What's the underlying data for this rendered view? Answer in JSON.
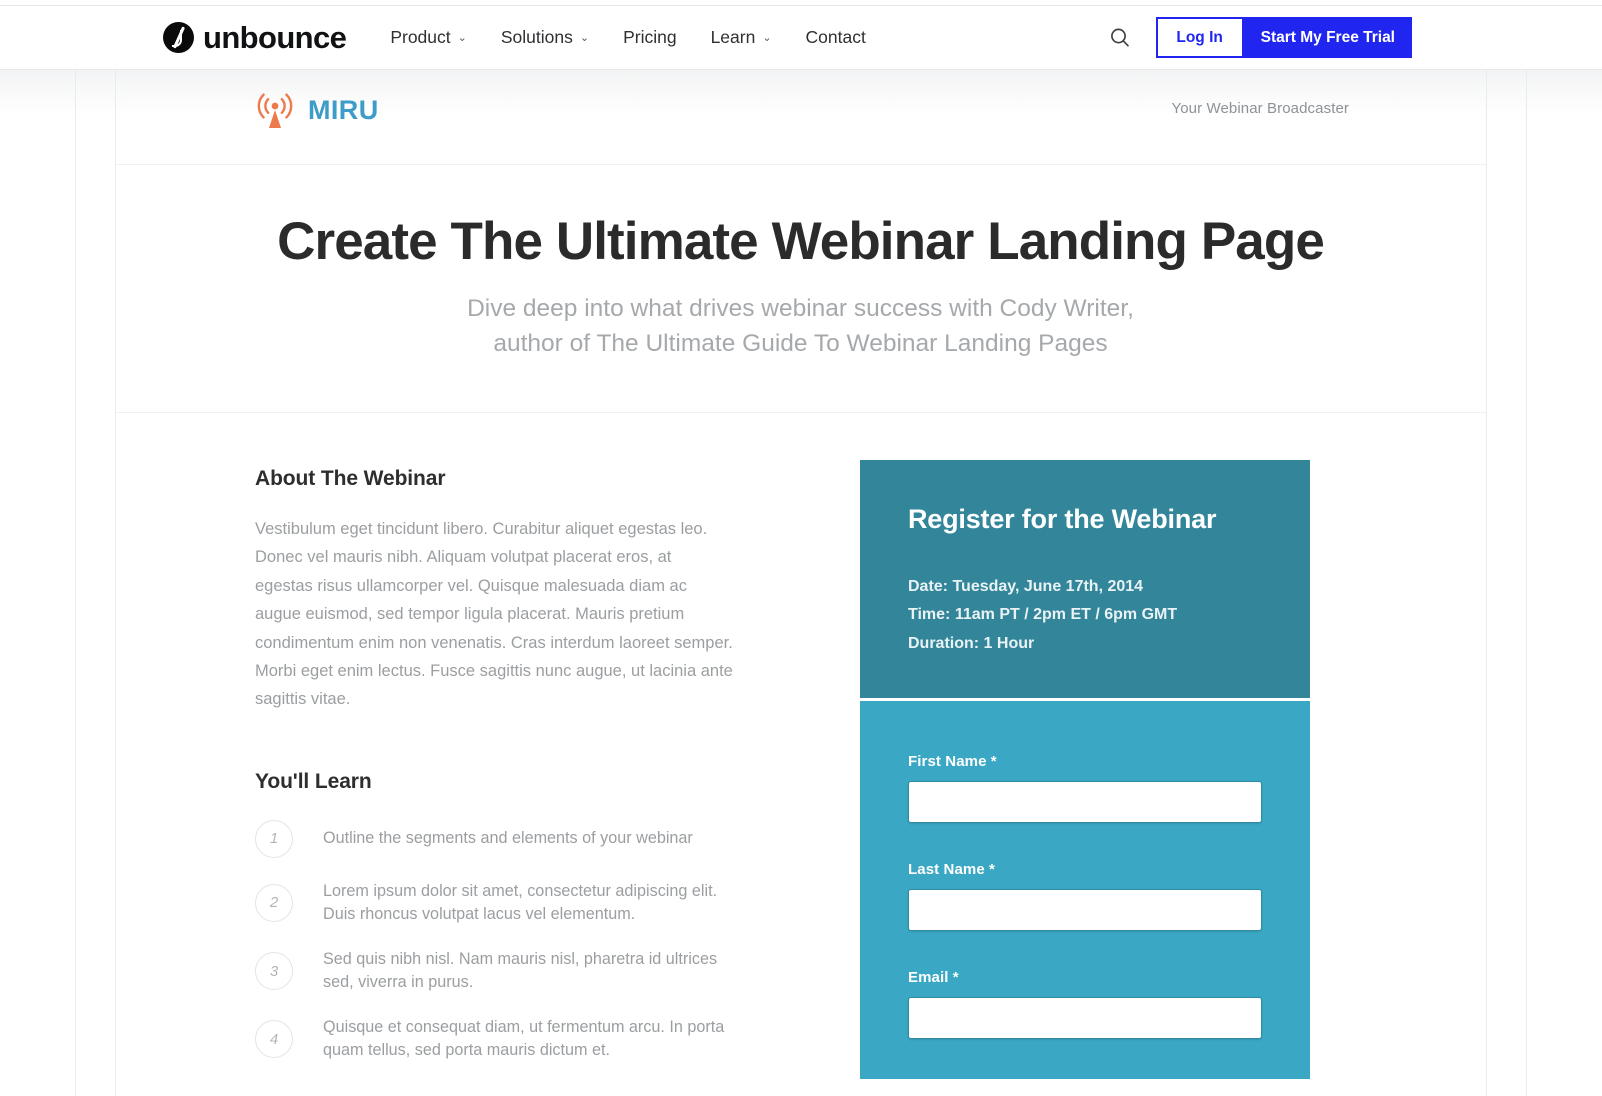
{
  "navbar": {
    "brand": "unbounce",
    "links": [
      {
        "label": "Product",
        "has_dropdown": true
      },
      {
        "label": "Solutions",
        "has_dropdown": true
      },
      {
        "label": "Pricing",
        "has_dropdown": false
      },
      {
        "label": "Learn",
        "has_dropdown": true
      },
      {
        "label": "Contact",
        "has_dropdown": false
      }
    ],
    "caret": "⌄",
    "search_icon": "search-icon",
    "login_label": "Log In",
    "trial_label": "Start My Free Trial",
    "accent_color": "#2026ef"
  },
  "page_header": {
    "logo_text": "MIRU",
    "logo_icon": "broadcast-antenna-icon",
    "logo_icon_color": "#ec7a4d",
    "logo_text_color": "#3e9cc9",
    "tagline": "Your Webinar Broadcaster"
  },
  "hero": {
    "title": "Create The Ultimate Webinar Landing Page",
    "subtitle_line_1": "Dive deep into what drives webinar success with Cody Writer,",
    "subtitle_line_2": "author of The Ultimate Guide To Webinar Landing Pages"
  },
  "about": {
    "heading": "About The Webinar",
    "paragraph": "Vestibulum eget tincidunt libero. Curabitur aliquet egestas leo. Donec vel mauris nibh. Aliquam volutpat placerat eros, at egestas risus ullamcorper vel. Quisque malesuada diam ac augue euismod, sed tempor ligula placerat. Mauris pretium condimentum enim non venenatis. Cras interdum laoreet semper. Morbi eget enim lectus. Fusce sagittis nunc augue, ut lacinia ante sagittis vitae."
  },
  "learn": {
    "heading": "You'll Learn",
    "items": [
      {
        "number": "1",
        "text": "Outline the segments and elements of your webinar"
      },
      {
        "number": "2",
        "text": "Lorem ipsum dolor sit amet, consectetur adipiscing elit. Duis rhoncus volutpat lacus vel elementum."
      },
      {
        "number": "3",
        "text": "Sed quis nibh nisl. Nam mauris nisl, pharetra id ultrices sed, viverra in purus."
      },
      {
        "number": "4",
        "text": "Quisque et consequat diam, ut fermentum arcu. In porta quam tellus, sed porta mauris dictum et."
      }
    ]
  },
  "register": {
    "heading": "Register for the Webinar",
    "header_color": "#33859a",
    "body_color": "#3aa8c4",
    "details": [
      "Date: Tuesday, June 17th, 2014",
      "Time: 11am PT / 2pm ET / 6pm GMT",
      "Duration: 1 Hour"
    ],
    "fields": [
      {
        "label": "First Name *",
        "value": "",
        "placeholder": ""
      },
      {
        "label": "Last Name *",
        "value": "",
        "placeholder": ""
      },
      {
        "label": "Email *",
        "value": "",
        "placeholder": ""
      }
    ]
  }
}
